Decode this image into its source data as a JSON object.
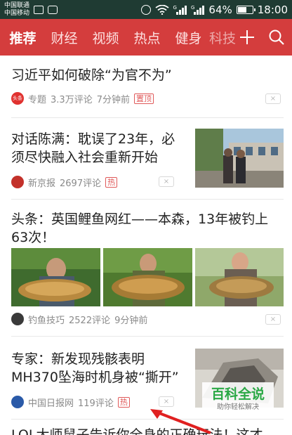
{
  "status_bar": {
    "carrier_1": "中国联通",
    "carrier_2": "中国移动",
    "signal_1_label": "G",
    "signal_2_label": "G",
    "battery_percent_text": "64%",
    "battery_level": 0.64,
    "time": "18:00"
  },
  "nav": {
    "tabs": [
      {
        "label": "推荐"
      },
      {
        "label": "财经"
      },
      {
        "label": "视频"
      },
      {
        "label": "热点"
      },
      {
        "label": "健身"
      },
      {
        "label": "科技"
      }
    ],
    "active_index": 0
  },
  "feed": [
    {
      "title": "习近平如何破除“为官不为”",
      "source_badge": "头条",
      "source": "专题",
      "comments": "3.3万评论",
      "time": "7分钟前",
      "tag": "置顶",
      "close": "×"
    },
    {
      "title_line1": "对话陈满：耽误了23年，必",
      "title_line2": "须尽快融入社会重新开始",
      "source": "新京报",
      "comments": "2697评论",
      "tag": "热",
      "close": "×"
    },
    {
      "title_line1": "头条：英国鲤鱼网红——本森，13年被钓上",
      "title_line2": "63次！",
      "source": "钓鱼技巧",
      "comments": "2522评论",
      "time": "9分钟前",
      "close": "×"
    },
    {
      "title_line1": "专家：新发现残骸表明",
      "title_line2": "MH370坠海时机身被“撕开”",
      "source": "中国日报网",
      "comments": "119评论",
      "tag": "热",
      "close": "×"
    },
    {
      "title_partial": "LOL大师鼠子告诉你全身的正确玩法！这才"
    }
  ],
  "watermark": {
    "title": "百科全说",
    "subtitle": "助你轻松解决"
  },
  "colors": {
    "nav_red": "#d43d3d",
    "status_bar": "#1f3b33",
    "tag_red": "#e05a5a",
    "watermark_green": "#2aa845"
  }
}
